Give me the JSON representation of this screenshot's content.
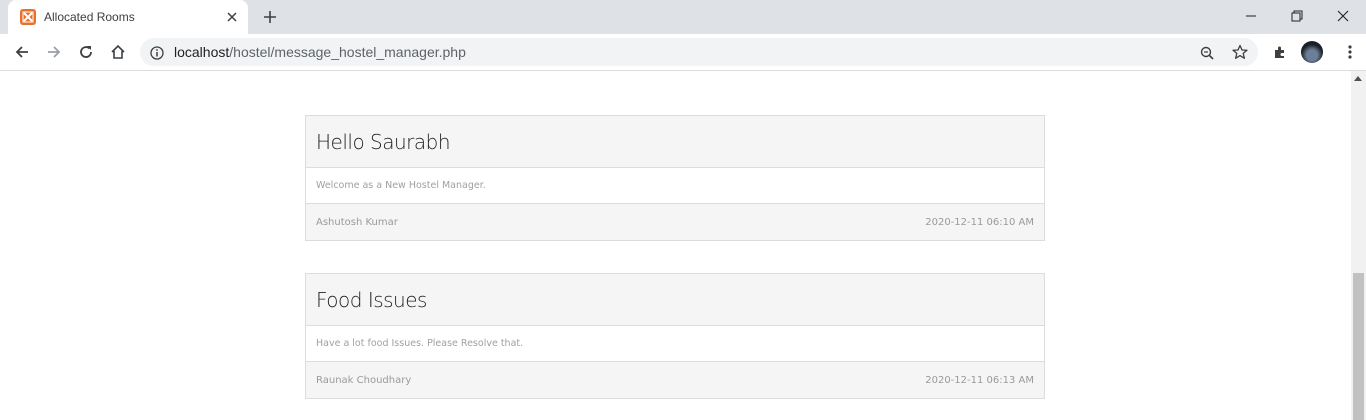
{
  "browser": {
    "tab_title": "Allocated Rooms",
    "url_host": "localhost",
    "url_path": "/hostel/message_hostel_manager.php"
  },
  "messages": [
    {
      "title": "Hello Saurabh",
      "body": "Welcome as a New Hostel Manager.",
      "author": "Ashutosh Kumar",
      "date": "2020-12-11 06:10 AM"
    },
    {
      "title": "Food Issues",
      "body": "Have a lot food Issues. Please Resolve that.",
      "author": "Raunak Choudhary",
      "date": "2020-12-11 06:13 AM"
    }
  ],
  "icons": {
    "favicon": "xampp-icon",
    "colors": {
      "favicon": "#e8702a",
      "tabstrip": "#dee1e6",
      "card_header": "#f5f5f5"
    }
  }
}
